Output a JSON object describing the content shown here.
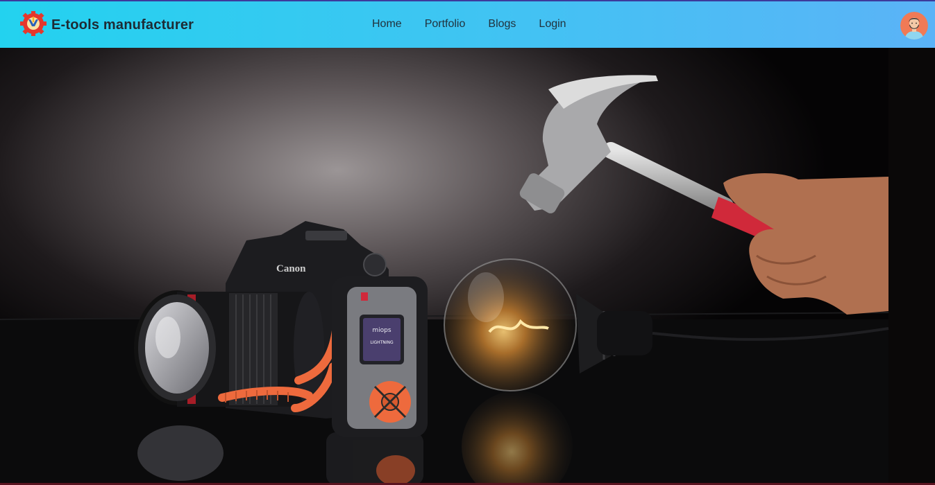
{
  "brand": {
    "title": "E-tools manufacturer",
    "logo_icon": "gear-tools-logo-icon"
  },
  "nav": {
    "items": [
      {
        "label": "Home"
      },
      {
        "label": "Portfolio"
      },
      {
        "label": "Blogs"
      },
      {
        "label": "Login"
      }
    ]
  },
  "user": {
    "avatar_icon": "user-avatar-icon"
  },
  "hero": {
    "image_subject": "camera-hammer-lightbulb-photo",
    "camera_brand": "Canon",
    "trigger_screen_title": "miops",
    "trigger_screen_mode": "LIGHTNING"
  },
  "colors": {
    "navbar_start": "#23d2ef",
    "navbar_end": "#5bb3f7",
    "navbar_text": "#21323d",
    "hammer_grip": "#d0293a",
    "accent_orange": "#ee6a3d"
  }
}
